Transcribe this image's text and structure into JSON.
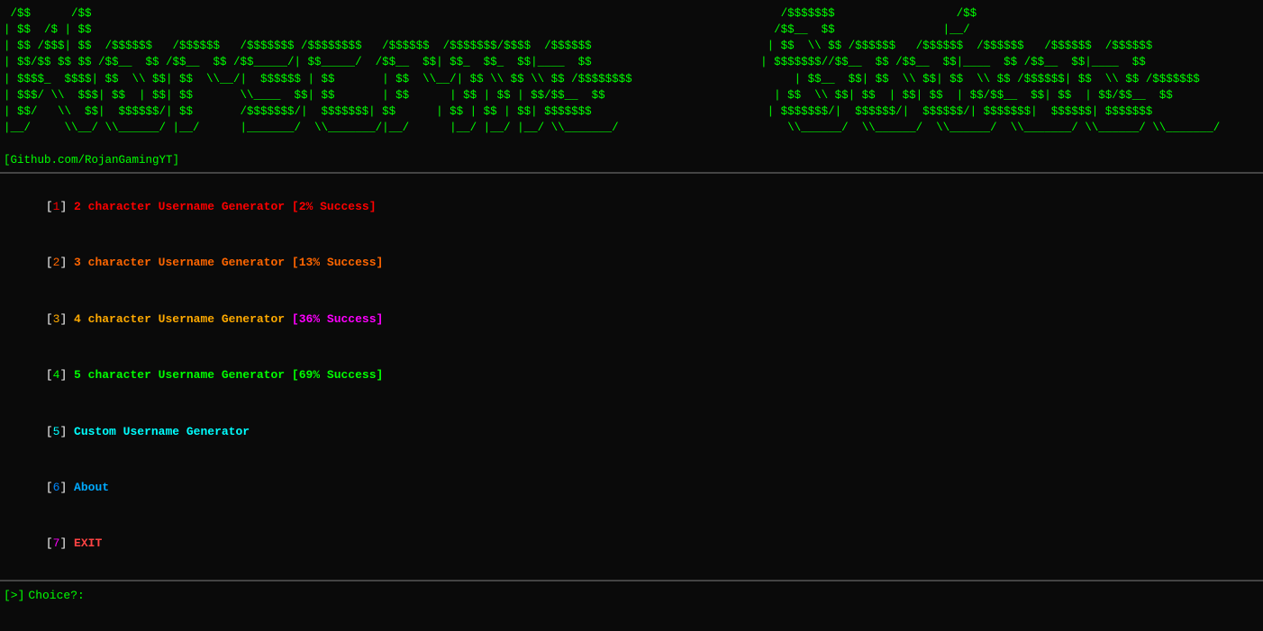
{
  "terminal": {
    "background": "#0a0a0a",
    "ascii_art_line1": " /$$      /$$                                                                                                      /$$$$$$$                  /$$  ",
    "ascii_art_line2": "| $$  /$ | $$                                                                                                     /$$__  $$                |__/  ",
    "ascii_art_line3": "| $$ /$$$| $$  /$$$$$$   /$$$$$$   /$$$$$$$ /$$$$$$$$   /$$$$$$  /$$$$$$$/$$$$  /$$$$$$                          | $$  \\ $$ /$$$$$$   /$$$$$$  /$$$$$$   /$$$$$$  /$$$$$$  ",
    "ascii_art_line4": "| $$/$$ $$ $$ /$$__  $$ /$$__  $$ /$$_____/| $$_____/  /$$__  $$| $$_  $$_  $$|____  $$                         | $$$$$$$//$$__  $$ /$$__  $$|____  $$ /$$__  $$|____  $$ ",
    "ascii_art_line5": "| $$$$_  $$$$| $$  \\ $$| $$  \\__/|  $$$$$$ | $$       | $$  \\__/| $$ \\ $$ \\ $$ /$$$$$$$$                        | $$__  $$| $$  \\ $$| $$  \\ $$ /$$$$$$| $$  \\ $$ /$$$$$$$ ",
    "ascii_art_line6": "| $$$/ \\  $$$| $$  | $$| $$       \\____  $$| $$       | $$      | $$ | $$ | $$/$$__  $$                         | $$  \\ $$| $$  | $$| $$  | $$/$$__  $$| $$  | $$/$$__  $$ ",
    "ascii_art_line7": "| $$/   \\  $$|  $$$$$$/| $$       /$$$$$$$/|  $$$$$$$| $$      | $$ | $$ | $$| $$$$$$$                          | $$$$$$$/|  $$$$$$/|  $$$$$$/| $$$$$$$|  $$$$$$| $$$$$$$ ",
    "ascii_art_line8": "|__/     \\__/ \\______/ |__/      |_______/  \\_______/|__/      |__/ |__/ |__/ \\_______/                         \\______/  \\______/  \\______/  \\_______/ \\______/ \\_______/ ",
    "github": "[Github.com/RojanGamingYT]",
    "menu": {
      "items": [
        {
          "num": "1",
          "label": "2 character Username Generator",
          "success": "[2% Success]",
          "num_color": "num-1",
          "label_color": "label-1",
          "success_color": "success-1"
        },
        {
          "num": "2",
          "label": "3 character Username Generator",
          "success": "[13% Success]",
          "num_color": "num-2",
          "label_color": "label-2",
          "success_color": "success-2"
        },
        {
          "num": "3",
          "label": "4 character Username Generator",
          "success": "[36% Success]",
          "num_color": "num-3",
          "label_color": "label-3",
          "success_color": "success-3"
        },
        {
          "num": "4",
          "label": "5 character Username Generator",
          "success": "[69% Success]",
          "num_color": "num-4",
          "label_color": "label-4",
          "success_color": "success-4"
        },
        {
          "num": "5",
          "label": "Custom Username Generator",
          "success": "",
          "num_color": "num-5",
          "label_color": "label-5",
          "success_color": ""
        },
        {
          "num": "6",
          "label": "About",
          "success": "",
          "num_color": "num-6",
          "label_color": "label-6",
          "success_color": ""
        },
        {
          "num": "7",
          "label": "EXIT",
          "success": "",
          "num_color": "num-7",
          "label_color": "label-7",
          "success_color": ""
        }
      ]
    },
    "prompt": "[>]",
    "choice_label": "Choice?: "
  }
}
